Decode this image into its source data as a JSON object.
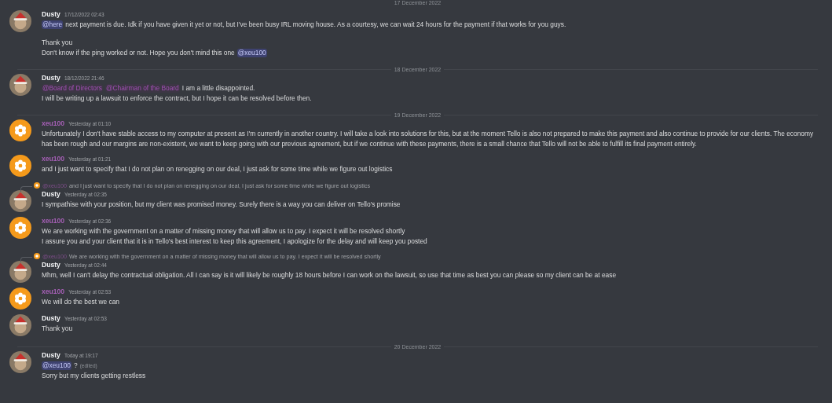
{
  "entries": [
    {
      "kind": "divider",
      "label": "17 December 2022"
    },
    {
      "kind": "message",
      "author": "Dusty",
      "color": "#f2f3f5",
      "avatar": {
        "kind": "picture"
      },
      "time": "17/12/2022 02:43",
      "paragraphs": [
        {
          "spaced": false,
          "segments": [
            {
              "kind": "mention",
              "text": "@here"
            },
            {
              "kind": "text",
              "text": "next payment is due. Idk if you have given it yet or not, but I've been busy IRL moving house. As a courtesy, we can wait 24 hours for the payment if that works for you guys."
            }
          ]
        },
        {
          "spaced": true,
          "segments": [
            {
              "kind": "text",
              "text": "Thank you"
            }
          ]
        },
        {
          "spaced": false,
          "segments": [
            {
              "kind": "text",
              "text": "Don't know if the ping worked or not. Hope you don't mind this one"
            },
            {
              "kind": "mention",
              "text": "@xeu100"
            }
          ]
        }
      ]
    },
    {
      "kind": "divider",
      "label": "18 December 2022"
    },
    {
      "kind": "message",
      "author": "Dusty",
      "color": "#f2f3f5",
      "avatar": {
        "kind": "picture"
      },
      "time": "18/12/2022 21:46",
      "paragraphs": [
        {
          "spaced": false,
          "segments": [
            {
              "kind": "role",
              "text": "@Board of Directors"
            },
            {
              "kind": "role",
              "text": "@Chairman of the Board"
            },
            {
              "kind": "text",
              "text": "I am a little disappointed."
            }
          ]
        },
        {
          "spaced": false,
          "segments": [
            {
              "kind": "text",
              "text": "I will be writing up a lawsuit to enforce the contract, but I hope it can be resolved before then."
            }
          ]
        }
      ]
    },
    {
      "kind": "divider",
      "label": "19 December 2022"
    },
    {
      "kind": "message",
      "author": "xeu100",
      "color": "#a55fb5",
      "avatar": {
        "kind": "flower"
      },
      "time": "Yesterday at 01:10",
      "paragraphs": [
        {
          "spaced": false,
          "segments": [
            {
              "kind": "text",
              "text": "Unfortunately I don't have stable access to my computer at present as I'm currently in another country. I will take a look into solutions for this, but at the moment Tello is also not prepared to make this payment and also continue to provide for our clients. The economy has been rough and our margins are non-existent, we want to keep going with our previous agreement, but if we continue with these payments, there is a small chance that Tello will not be able to fulfill its final payment entirely."
            }
          ]
        }
      ]
    },
    {
      "kind": "message",
      "author": "xeu100",
      "color": "#a55fb5",
      "avatar": {
        "kind": "flower"
      },
      "time": "Yesterday at 01:21",
      "paragraphs": [
        {
          "spaced": false,
          "segments": [
            {
              "kind": "text",
              "text": "and I just want to specify that I do not plan on renegging on our deal, I just ask for some time while we figure out logistics"
            }
          ]
        }
      ]
    },
    {
      "kind": "message",
      "author": "Dusty",
      "color": "#f2f3f5",
      "avatar": {
        "kind": "picture"
      },
      "time": "Yesterday at 02:35",
      "reply": {
        "author": "@xeu100",
        "text": "and I just want to specify that I do not plan on renegging on our deal, I just ask for some time while we figure out logistics"
      },
      "paragraphs": [
        {
          "spaced": false,
          "segments": [
            {
              "kind": "text",
              "text": "I sympathise with your position, but my client was promised money. Surely there is a way you can deliver on Tello's promise"
            }
          ]
        }
      ]
    },
    {
      "kind": "message",
      "author": "xeu100",
      "color": "#a55fb5",
      "avatar": {
        "kind": "flower"
      },
      "time": "Yesterday at 02:36",
      "paragraphs": [
        {
          "spaced": false,
          "segments": [
            {
              "kind": "text",
              "text": "We are working with the government on a matter of missing money that will allow us to pay. I expect it will be resolved shortly"
            }
          ]
        },
        {
          "spaced": false,
          "segments": [
            {
              "kind": "text",
              "text": "I assure you and your client that it is in Tello's best interest to keep this agreement, I apologize for the delay and will keep you posted"
            }
          ]
        }
      ]
    },
    {
      "kind": "message",
      "author": "Dusty",
      "color": "#f2f3f5",
      "avatar": {
        "kind": "picture"
      },
      "time": "Yesterday at 02:44",
      "reply": {
        "author": "@xeu100",
        "text": "We are working with the government on a matter of missing money that will allow us to pay. I expect it will be resolved shortly"
      },
      "paragraphs": [
        {
          "spaced": false,
          "segments": [
            {
              "kind": "text",
              "text": "Mhm, well I can't delay the contractual obligation. All I can say is it will likely be roughly 18 hours before I can work on the lawsuit, so use that time as best you can please so my client can be at ease"
            }
          ]
        }
      ]
    },
    {
      "kind": "message",
      "author": "xeu100",
      "color": "#a55fb5",
      "avatar": {
        "kind": "flower"
      },
      "time": "Yesterday at 02:53",
      "paragraphs": [
        {
          "spaced": false,
          "segments": [
            {
              "kind": "text",
              "text": "We will do the best we can"
            }
          ]
        }
      ]
    },
    {
      "kind": "message",
      "author": "Dusty",
      "color": "#f2f3f5",
      "avatar": {
        "kind": "picture"
      },
      "time": "Yesterday at 02:53",
      "paragraphs": [
        {
          "spaced": false,
          "segments": [
            {
              "kind": "text",
              "text": "Thank you"
            }
          ]
        }
      ]
    },
    {
      "kind": "divider",
      "label": "20 December 2022"
    },
    {
      "kind": "message",
      "author": "Dusty",
      "color": "#f2f3f5",
      "avatar": {
        "kind": "picture"
      },
      "time": "Today at 19:17",
      "paragraphs": [
        {
          "spaced": false,
          "segments": [
            {
              "kind": "mention",
              "text": "@xeu100"
            },
            {
              "kind": "text",
              "text": "?"
            },
            {
              "kind": "edited",
              "text": "(edited)"
            }
          ]
        },
        {
          "spaced": false,
          "segments": [
            {
              "kind": "text",
              "text": "Sorry but my clients getting restless"
            }
          ]
        }
      ]
    }
  ]
}
